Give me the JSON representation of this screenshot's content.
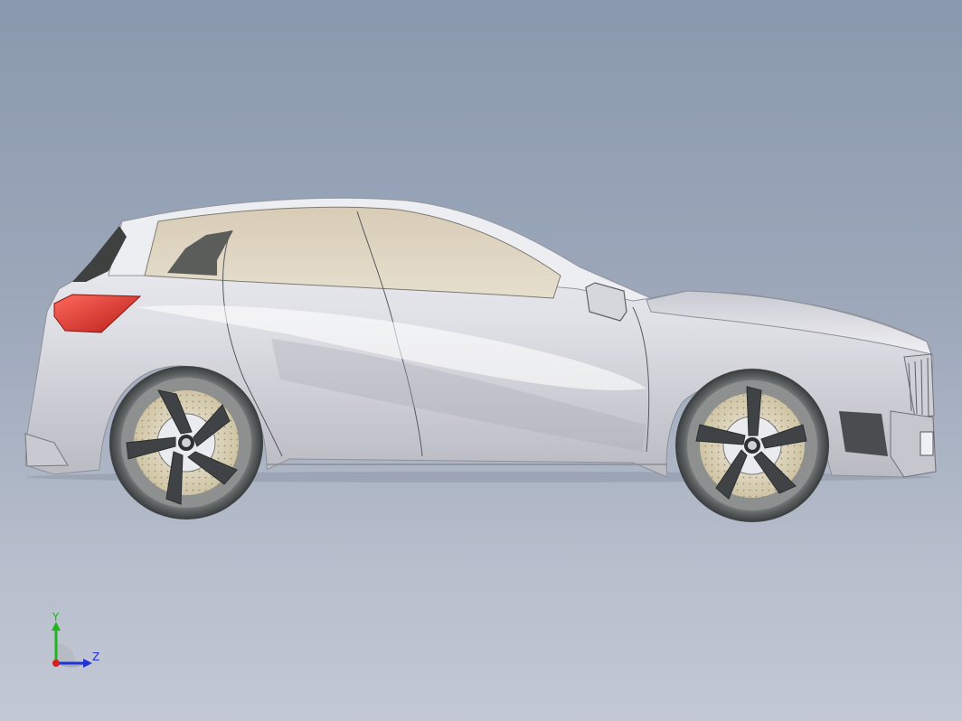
{
  "viewport": {
    "background_top": "#8a99ad",
    "background_bottom": "#c3c8d4"
  },
  "model": {
    "body_color": "#dcdde3",
    "glass_color": "#dcd3c0",
    "tail_light_color": "#e0342c",
    "tire_color": "#555a5c",
    "rotor_color": "#d8cfb0"
  },
  "triad": {
    "y_label": "Y",
    "z_label": "Z",
    "y_color": "#1fb51f",
    "z_color": "#1f33d6",
    "x_color": "#d62020"
  }
}
